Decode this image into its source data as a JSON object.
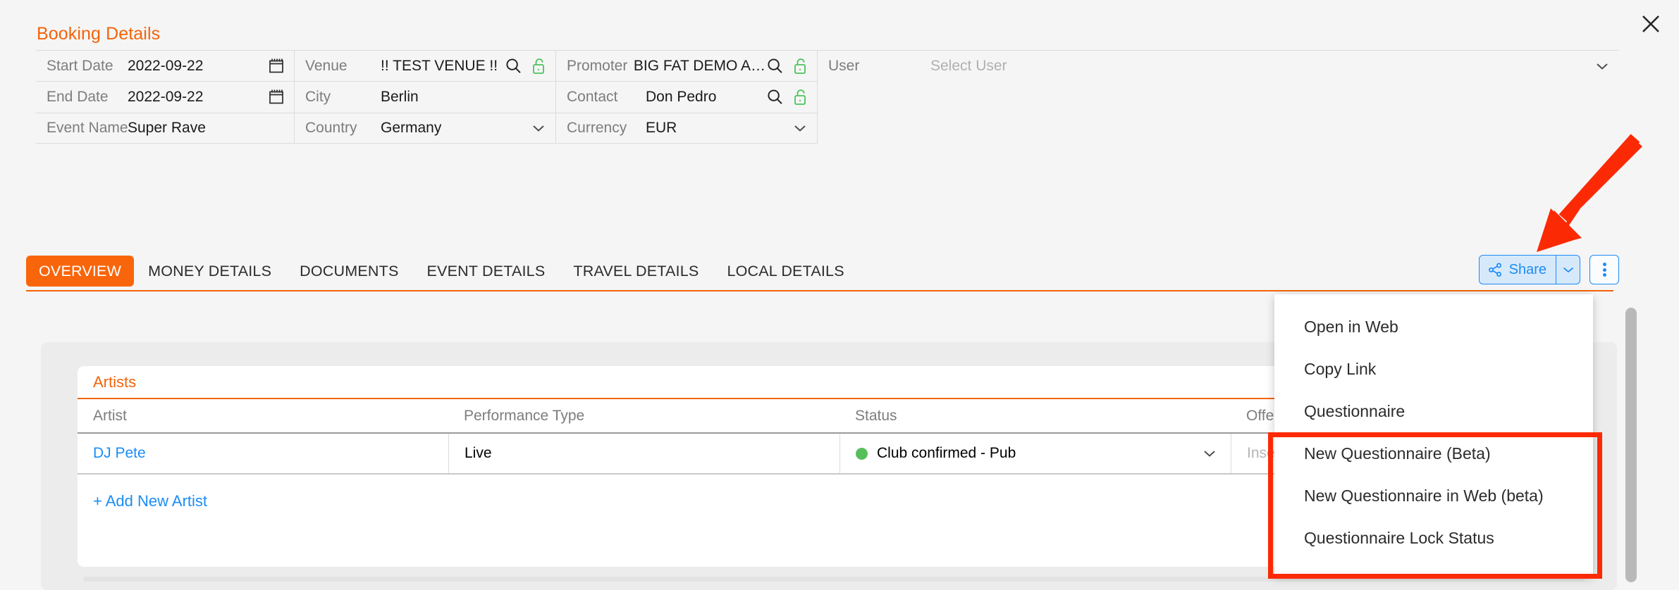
{
  "window": {
    "close_label": "✕",
    "close_icon": "close-icon"
  },
  "section": {
    "title": "Booking Details"
  },
  "details": {
    "col1": [
      {
        "label": "Start Date",
        "value": "2022-09-22",
        "icon": "calendar-icon"
      },
      {
        "label": "End Date",
        "value": "2022-09-22",
        "icon": "calendar-icon"
      },
      {
        "label": "Event Name",
        "value": "Super Rave",
        "icon": ""
      }
    ],
    "col2": [
      {
        "label": "Venue",
        "value": "!! TEST VENUE !!",
        "icons": "search-icon,unlock-icon"
      },
      {
        "label": "City",
        "value": "Berlin",
        "icons": ""
      },
      {
        "label": "Country",
        "value": "Germany",
        "icons": "chevron-down-icon"
      }
    ],
    "col3": [
      {
        "label": "Promoter",
        "value": "BIG FAT DEMO AGE …",
        "icons": "search-icon,unlock-icon"
      },
      {
        "label": "Contact",
        "value": "Don Pedro",
        "icons": "search-icon,unlock-icon"
      },
      {
        "label": "Currency",
        "value": "EUR",
        "icons": "chevron-down-icon"
      }
    ],
    "col4": [
      {
        "label": "User",
        "value": "Select User",
        "icons": "chevron-down-icon",
        "is_placeholder": true
      }
    ]
  },
  "tabs": [
    {
      "label": "OVERVIEW",
      "active": true
    },
    {
      "label": "MONEY DETAILS",
      "active": false
    },
    {
      "label": "DOCUMENTS",
      "active": false
    },
    {
      "label": "EVENT DETAILS",
      "active": false
    },
    {
      "label": "TRAVEL DETAILS",
      "active": false
    },
    {
      "label": "LOCAL DETAILS",
      "active": false
    }
  ],
  "toolbar": {
    "share_label": "Share",
    "share_icon": "share-nodes-icon",
    "share_caret_icon": "chevron-down-icon",
    "kebab_icon": "more-vertical-icon"
  },
  "share_menu": {
    "items": [
      {
        "label": "Open in Web",
        "highlighted": false
      },
      {
        "label": "Copy Link",
        "highlighted": false
      },
      {
        "label": "Questionnaire",
        "highlighted": false
      },
      {
        "label": "New Questionnaire (Beta)",
        "highlighted": true
      },
      {
        "label": "New Questionnaire in Web (beta)",
        "highlighted": true
      },
      {
        "label": "Questionnaire Lock Status",
        "highlighted": true
      }
    ]
  },
  "artists": {
    "card_title": "Artists",
    "columns": [
      "Artist",
      "Performance Type",
      "Status",
      "Offer Notes"
    ],
    "rows": [
      {
        "artist": "DJ Pete",
        "performance_type": "Live",
        "status": "Club confirmed - Pub",
        "status_color": "#56bf5c",
        "offer_notes_placeholder": "Insert Offer No"
      }
    ],
    "add_label": "+ Add New Artist"
  },
  "colors": {
    "accent_orange": "#f2640a",
    "tab_active_orange": "#f9650b",
    "link_blue": "#1c8cf5",
    "status_green": "#56bf5c",
    "annotation_red": "#fb2a05",
    "page_bg": "#f5f5f5"
  }
}
